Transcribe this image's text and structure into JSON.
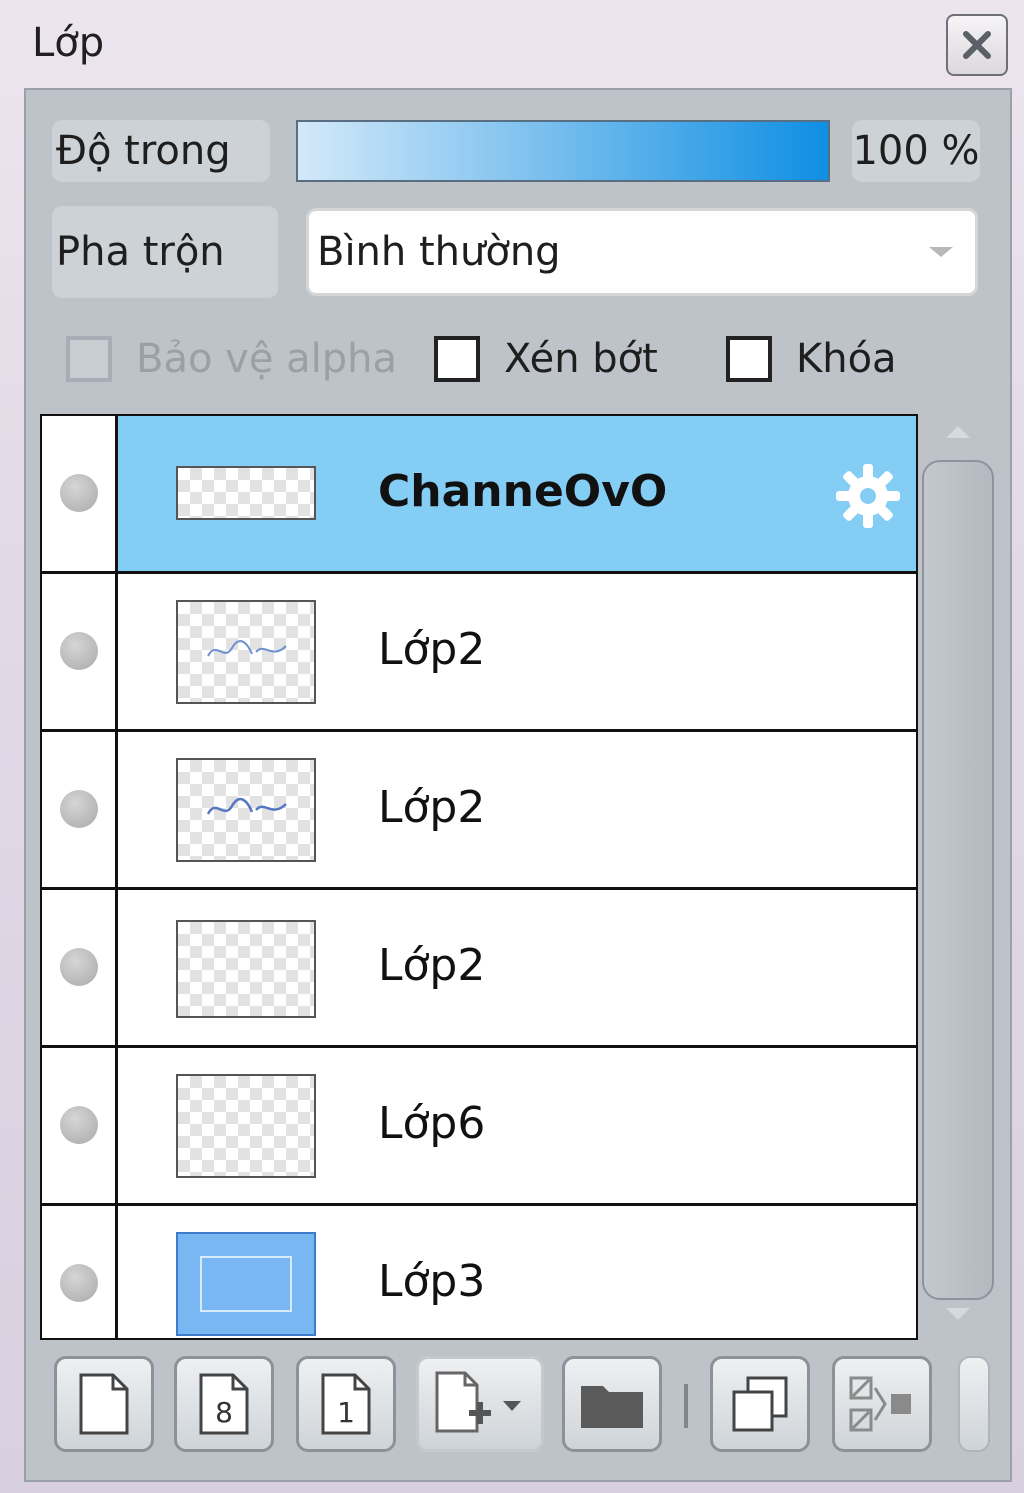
{
  "window": {
    "title": "Lớp"
  },
  "opacity": {
    "label": "Độ trong",
    "value_text": "100 %",
    "percent": 100
  },
  "blend": {
    "label": "Pha trộn",
    "value": "Bình thường"
  },
  "options": {
    "protect_alpha": "Bảo vệ alpha",
    "clipping": "Xén bớt",
    "lock": "Khóa"
  },
  "layers": [
    {
      "name": "ChanneOvO",
      "active": true
    },
    {
      "name": "Lớp2",
      "active": false
    },
    {
      "name": "Lớp2",
      "active": false
    },
    {
      "name": "Lớp2",
      "active": false
    },
    {
      "name": "Lớp6",
      "active": false
    },
    {
      "name": "Lớp3",
      "active": false
    }
  ],
  "toolbar": {
    "icons": [
      "new-layer-icon",
      "new-8bit-layer-icon",
      "new-1bit-layer-icon",
      "add-layer-dropdown-icon",
      "folder-icon",
      "duplicate-icon",
      "merge-down-icon"
    ],
    "button_8_label": "8",
    "button_1_label": "1"
  },
  "colors": {
    "selected_row": "#84cdf5",
    "opacity_bar": "#0f8fe3"
  }
}
